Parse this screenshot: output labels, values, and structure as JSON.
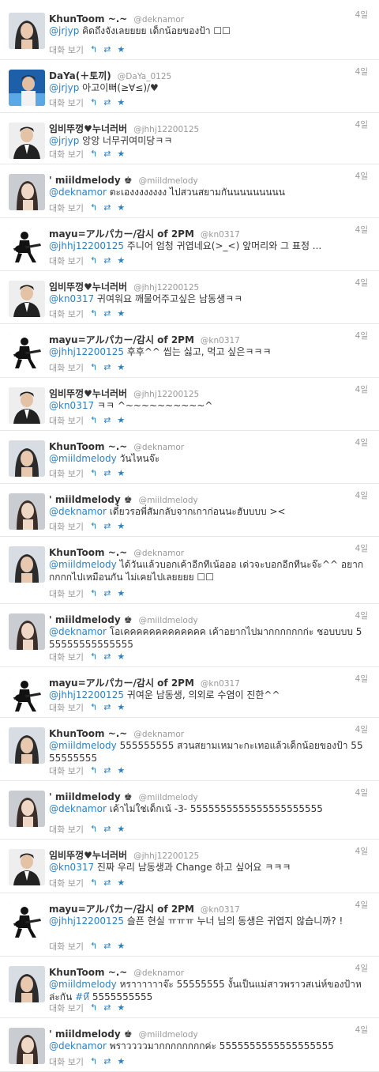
{
  "actions": {
    "expand_label": "대화 보기",
    "reply_icon": "↰",
    "retweet_icon": "⇄",
    "favorite_icon": "★"
  },
  "tweets": [
    {
      "name": "KhunToom ~.~",
      "handle": "@deknamor",
      "time": "4일",
      "mention": "@jrjyp",
      "text": "คิดถึงจังเลยยยย เด็กน้อยของป้า ☐☐",
      "avatar": "girl-long-hair"
    },
    {
      "name": "DaYa(＋토끼)",
      "handle": "@DaYa_0125",
      "time": "4일",
      "mention": "@jrjyp",
      "text": "아고이뻐(≥∀≤)/♥",
      "avatar": "boy-blue"
    },
    {
      "name": "임비뚜껑♥누너러버",
      "handle": "@jhhj12200125",
      "time": "4일",
      "mention": "@jrjyp",
      "text": "앙앙 너무귀여미당ㅋㅋ",
      "avatar": "man-suit"
    },
    {
      "name": "' miildmelody ♚",
      "handle": "@miildmelody",
      "time": "4일",
      "mention": "@deknamor",
      "text": "ตะเองงงงงงงง ไปสวนสยามกันนนนนนนนน",
      "avatar": "girl-selfie"
    },
    {
      "name": "mayu=アルパカー/감시 of 2PM",
      "handle": "@kn0317",
      "time": "4일",
      "mention": "@jhhj12200125",
      "text": "주니어 엄청 귀엽네요(>_<) 앞머리와 그 표정 ...",
      "avatar": "guitarist"
    },
    {
      "name": "임비뚜껑♥누너러버",
      "handle": "@jhhj12200125",
      "time": "4일",
      "mention": "@kn0317",
      "text": "귀여워요 깨물어주고싶은 남동생ㅋㅋ",
      "avatar": "man-suit"
    },
    {
      "name": "mayu=アルパカー/감시 of 2PM",
      "handle": "@kn0317",
      "time": "4일",
      "mention": "@jhhj12200125",
      "text": "후후^^ 씹는 싫고, 먹고 싶은ㅋㅋㅋ",
      "avatar": "guitarist"
    },
    {
      "name": "임비뚜껑♥누너러버",
      "handle": "@jhhj12200125",
      "time": "4일",
      "mention": "@kn0317",
      "text": "ㅋㅋ ^~~~~~~~~~~^",
      "avatar": "man-suit"
    },
    {
      "name": "KhunToom ~.~",
      "handle": "@deknamor",
      "time": "4일",
      "mention": "@miildmelody",
      "text": "วันไหนจ๊ะ",
      "avatar": "girl-long-hair"
    },
    {
      "name": "' miildmelody ♚",
      "handle": "@miildmelody",
      "time": "4일",
      "mention": "@deknamor",
      "text": "เดี๋ยวรอพี่สัมกลับจากเกาก่อนนะฮับบบบ ><",
      "avatar": "girl-selfie"
    },
    {
      "name": "KhunToom ~.~",
      "handle": "@deknamor",
      "time": "4일",
      "mention": "@miildmelody",
      "text": "ได้วันแล้วบอกเค้าอีกทีเน้อออ เด่วจะบอกอีกทีนะจ๊ะ^^ อยากกกกกไปเหมือนกัน ไม่เคยไปเลยยยย ☐☐",
      "avatar": "girl-long-hair"
    },
    {
      "name": "' miildmelody ♚",
      "handle": "@miildmelody",
      "time": "4일",
      "mention": "@deknamor",
      "text": "โอเคคคคคคคคคคคคค เค้าอยากไปมากกกกกกก่ะ ชอบบบบ 555555555555555",
      "avatar": "girl-selfie"
    },
    {
      "name": "mayu=アルパカー/감시 of 2PM",
      "handle": "@kn0317",
      "time": "4일",
      "mention": "@jhhj12200125",
      "text": "귀여운 남동생, 의외로 수염이 진한^^",
      "avatar": "guitarist"
    },
    {
      "name": "KhunToom ~.~",
      "handle": "@deknamor",
      "time": "4일",
      "mention": "@miildmelody",
      "text": "555555555 สวนสยามเหมาะกะเทอแล้วเด็กน้อยของป้า 5555555555",
      "avatar": "girl-long-hair"
    },
    {
      "name": "' miildmelody ♚",
      "handle": "@miildmelody",
      "time": "4일",
      "mention": "@deknamor",
      "text": "เค้าไม่ใช่เด็กเน้ -3- 5555555555555555555555",
      "avatar": "girl-selfie"
    },
    {
      "name": "임비뚜껑♥누너러버",
      "handle": "@jhhj12200125",
      "time": "4일",
      "mention": "@kn0317",
      "text": "진짜 우리 남동생과 Change 하고 싶어요 ㅋㅋㅋ",
      "avatar": "man-suit"
    },
    {
      "name": "mayu=アルパカー/감시 of 2PM",
      "handle": "@kn0317",
      "time": "4일",
      "mention": "@jhhj12200125",
      "text": "슬픈 현실 ㅠㅠㅠ 누너 님의 동생은 귀엽지 않습니까? !",
      "avatar": "guitarist"
    },
    {
      "name": "KhunToom ~.~",
      "handle": "@deknamor",
      "time": "4일",
      "mention": "@miildmelody",
      "text": "หราาาาาาจ๊ะ 55555555 งั้นเป็นแม่สาวพราวสเน่ห์ของป้าหล่ะกัน",
      "hashtag": "#หึ",
      "text_after": " 5555555555",
      "avatar": "girl-long-hair"
    },
    {
      "name": "' miildmelody ♚",
      "handle": "@miildmelody",
      "time": "4일",
      "mention": "@deknamor",
      "text": "พราววววมากกกกกกกกค่ะ 5555555555555555555",
      "avatar": "girl-selfie"
    }
  ]
}
